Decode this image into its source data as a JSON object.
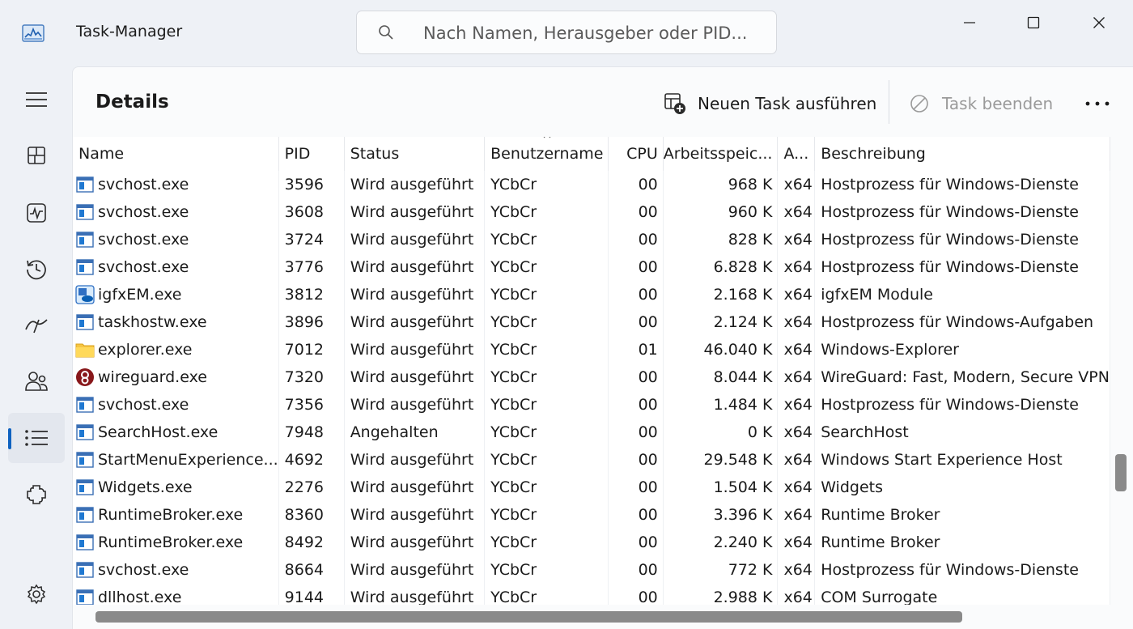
{
  "window": {
    "title": "Task-Manager",
    "search_placeholder": "Nach Namen, Herausgeber oder PID..."
  },
  "nav": {
    "items": [
      {
        "icon": "hamburger-icon"
      },
      {
        "icon": "processes-icon"
      },
      {
        "icon": "performance-icon"
      },
      {
        "icon": "app-history-icon"
      },
      {
        "icon": "startup-apps-icon"
      },
      {
        "icon": "users-icon"
      },
      {
        "icon": "details-icon",
        "active": true
      },
      {
        "icon": "services-icon"
      },
      {
        "icon": "settings-icon"
      }
    ]
  },
  "page": {
    "title": "Details",
    "run_task_label": "Neuen Task ausführen",
    "end_task_label": "Task beenden"
  },
  "table": {
    "columns": [
      "Name",
      "PID",
      "Status",
      "Benutzername",
      "CPU",
      "Arbeitsspeic...",
      "A...",
      "Beschreibung"
    ],
    "rows": [
      {
        "icon": "generic-exe",
        "name": "svchost.exe",
        "pid": "3596",
        "status": "Wird ausgeführt",
        "user": "YCbCr",
        "cpu": "00",
        "mem": "968 K",
        "arch": "x64",
        "desc": "Hostprozess für Windows-Dienste"
      },
      {
        "icon": "generic-exe",
        "name": "svchost.exe",
        "pid": "3608",
        "status": "Wird ausgeführt",
        "user": "YCbCr",
        "cpu": "00",
        "mem": "960 K",
        "arch": "x64",
        "desc": "Hostprozess für Windows-Dienste"
      },
      {
        "icon": "generic-exe",
        "name": "svchost.exe",
        "pid": "3724",
        "status": "Wird ausgeführt",
        "user": "YCbCr",
        "cpu": "00",
        "mem": "828 K",
        "arch": "x64",
        "desc": "Hostprozess für Windows-Dienste"
      },
      {
        "icon": "generic-exe",
        "name": "svchost.exe",
        "pid": "3776",
        "status": "Wird ausgeführt",
        "user": "YCbCr",
        "cpu": "00",
        "mem": "6.828 K",
        "arch": "x64",
        "desc": "Hostprozess für Windows-Dienste"
      },
      {
        "icon": "intel",
        "name": "igfxEM.exe",
        "pid": "3812",
        "status": "Wird ausgeführt",
        "user": "YCbCr",
        "cpu": "00",
        "mem": "2.168 K",
        "arch": "x64",
        "desc": "igfxEM Module"
      },
      {
        "icon": "generic-exe",
        "name": "taskhostw.exe",
        "pid": "3896",
        "status": "Wird ausgeführt",
        "user": "YCbCr",
        "cpu": "00",
        "mem": "2.124 K",
        "arch": "x64",
        "desc": "Hostprozess für Windows-Aufgaben"
      },
      {
        "icon": "folder",
        "name": "explorer.exe",
        "pid": "7012",
        "status": "Wird ausgeführt",
        "user": "YCbCr",
        "cpu": "01",
        "mem": "46.040 K",
        "arch": "x64",
        "desc": "Windows-Explorer"
      },
      {
        "icon": "wireguard",
        "name": "wireguard.exe",
        "pid": "7320",
        "status": "Wird ausgeführt",
        "user": "YCbCr",
        "cpu": "00",
        "mem": "8.044 K",
        "arch": "x64",
        "desc": "WireGuard: Fast, Modern, Secure VPN"
      },
      {
        "icon": "generic-exe",
        "name": "svchost.exe",
        "pid": "7356",
        "status": "Wird ausgeführt",
        "user": "YCbCr",
        "cpu": "00",
        "mem": "1.484 K",
        "arch": "x64",
        "desc": "Hostprozess für Windows-Dienste"
      },
      {
        "icon": "generic-exe",
        "name": "SearchHost.exe",
        "pid": "7948",
        "status": "Angehalten",
        "user": "YCbCr",
        "cpu": "00",
        "mem": "0 K",
        "arch": "x64",
        "desc": "SearchHost"
      },
      {
        "icon": "generic-exe",
        "name": "StartMenuExperience...",
        "pid": "4692",
        "status": "Wird ausgeführt",
        "user": "YCbCr",
        "cpu": "00",
        "mem": "29.548 K",
        "arch": "x64",
        "desc": "Windows Start Experience Host"
      },
      {
        "icon": "generic-exe",
        "name": "Widgets.exe",
        "pid": "2276",
        "status": "Wird ausgeführt",
        "user": "YCbCr",
        "cpu": "00",
        "mem": "1.504 K",
        "arch": "x64",
        "desc": "Widgets"
      },
      {
        "icon": "generic-exe",
        "name": "RuntimeBroker.exe",
        "pid": "8360",
        "status": "Wird ausgeführt",
        "user": "YCbCr",
        "cpu": "00",
        "mem": "3.396 K",
        "arch": "x64",
        "desc": "Runtime Broker"
      },
      {
        "icon": "generic-exe",
        "name": "RuntimeBroker.exe",
        "pid": "8492",
        "status": "Wird ausgeführt",
        "user": "YCbCr",
        "cpu": "00",
        "mem": "2.240 K",
        "arch": "x64",
        "desc": "Runtime Broker"
      },
      {
        "icon": "generic-exe",
        "name": "svchost.exe",
        "pid": "8664",
        "status": "Wird ausgeführt",
        "user": "YCbCr",
        "cpu": "00",
        "mem": "772 K",
        "arch": "x64",
        "desc": "Hostprozess für Windows-Dienste"
      },
      {
        "icon": "generic-exe",
        "name": "dllhost.exe",
        "pid": "9144",
        "status": "Wird ausgeführt",
        "user": "YCbCr",
        "cpu": "00",
        "mem": "2.988 K",
        "arch": "x64",
        "desc": "COM Surrogate"
      }
    ]
  },
  "colors": {
    "accent": "#0f62c0",
    "window_bg": "#eef1f6",
    "panel_bg": "#fafbfc",
    "disabled_text": "#9a9a9a",
    "scrollbar": "#8a8a8a"
  }
}
